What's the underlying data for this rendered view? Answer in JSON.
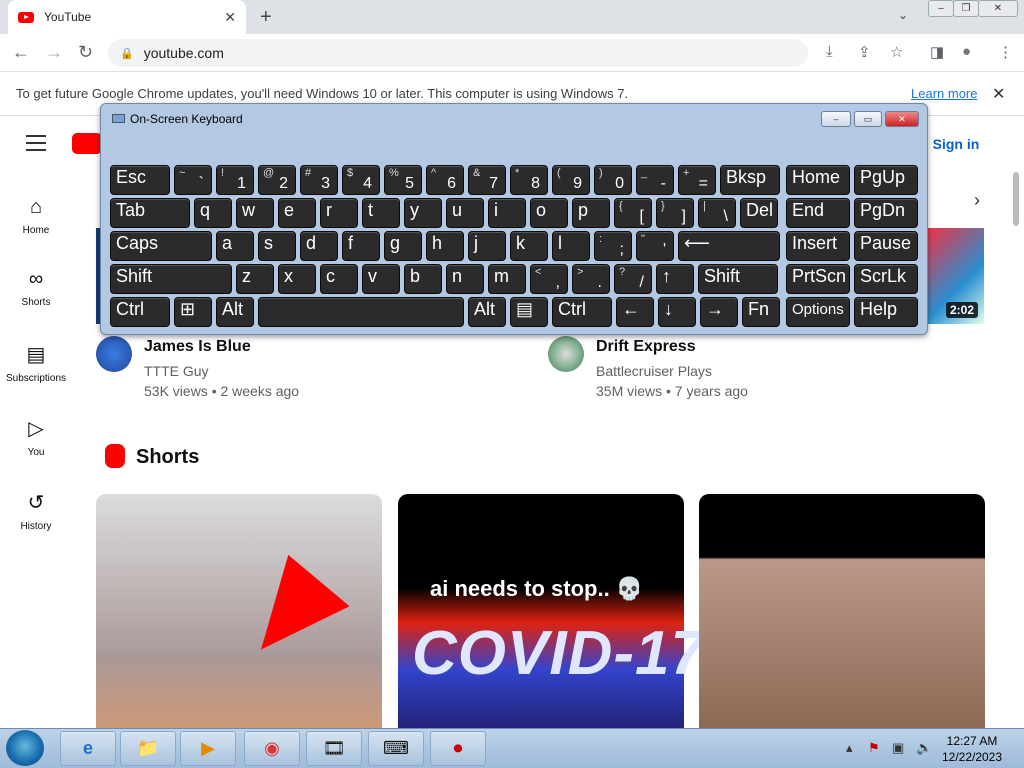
{
  "browser": {
    "tab_title": "YouTube",
    "tab_close": "✕",
    "new_tab": "+",
    "tab_dropdown": "⌄",
    "url": "youtube.com",
    "win_buttons": [
      "‒",
      "❐",
      "✕"
    ],
    "nav": {
      "back": "←",
      "forward": "→",
      "reload": "↻"
    },
    "toolbar_icons": {
      "install": "⤓",
      "share": "⇪",
      "bookmark": "☆",
      "sidepanel": "◨",
      "profile": "●",
      "menu": "⋮"
    }
  },
  "infobar": {
    "message": "To get future Google Chrome updates, you'll need Windows 10 or later. This computer is using Windows 7.",
    "link": "Learn more",
    "close": "✕"
  },
  "youtube": {
    "sign_in": "Sign in",
    "sidebar": [
      {
        "label": "Home",
        "icon": "⌂"
      },
      {
        "label": "Shorts",
        "icon": "∞"
      },
      {
        "label": "Subscriptions",
        "icon": "▤"
      },
      {
        "label": "You",
        "icon": "▷"
      },
      {
        "label": "History",
        "icon": "↺"
      }
    ],
    "duration_badge": "2:02",
    "chip_next": "›",
    "videos": [
      {
        "title": "James Is Blue",
        "channel": "TTTE Guy",
        "meta": "53K views • 2 weeks ago"
      },
      {
        "title": "Drift Express",
        "channel": "Battlecruiser Plays",
        "meta": "35M views • 7 years ago"
      }
    ],
    "shorts_heading": "Shorts",
    "short2_caption": "ai needs to stop.. 💀",
    "short2_big": "COVID-17"
  },
  "keyboard": {
    "title": "On-Screen Keyboard",
    "buttons": [
      "‒",
      "▭",
      "✕"
    ],
    "keys": [
      {
        "m": "Esc",
        "w": 60
      },
      {
        "s": "~",
        "l": "`",
        "w": 38
      },
      {
        "s": "!",
        "l": "1",
        "w": 38
      },
      {
        "s": "@",
        "l": "2",
        "w": 38
      },
      {
        "s": "#",
        "l": "3",
        "w": 38
      },
      {
        "s": "$",
        "l": "4",
        "w": 38
      },
      {
        "s": "%",
        "l": "5",
        "w": 38
      },
      {
        "s": "^",
        "l": "6",
        "w": 38
      },
      {
        "s": "&",
        "l": "7",
        "w": 38
      },
      {
        "s": "*",
        "l": "8",
        "w": 38
      },
      {
        "s": "(",
        "l": "9",
        "w": 38
      },
      {
        "s": ")",
        "l": "0",
        "w": 38
      },
      {
        "s": "_",
        "l": "-",
        "w": 38
      },
      {
        "s": "+",
        "l": "=",
        "w": 38
      },
      {
        "m": "Bksp",
        "w": 60
      },
      {
        "m": "Home",
        "w": 64
      },
      {
        "m": "PgUp",
        "w": 64
      },
      {
        "m": "Tab",
        "w": 80
      },
      {
        "m": "q",
        "w": 38
      },
      {
        "m": "w",
        "w": 38
      },
      {
        "m": "e",
        "w": 38
      },
      {
        "m": "r",
        "w": 38
      },
      {
        "m": "t",
        "w": 38
      },
      {
        "m": "y",
        "w": 38
      },
      {
        "m": "u",
        "w": 38
      },
      {
        "m": "i",
        "w": 38
      },
      {
        "m": "o",
        "w": 38
      },
      {
        "m": "p",
        "w": 38
      },
      {
        "s": "{",
        "l": "[",
        "w": 38
      },
      {
        "s": "}",
        "l": "]",
        "w": 38
      },
      {
        "s": "|",
        "l": "\\",
        "w": 38
      },
      {
        "m": "Del",
        "w": 38
      },
      {
        "m": "End",
        "w": 64
      },
      {
        "m": "PgDn",
        "w": 64
      },
      {
        "m": "Caps",
        "w": 102
      },
      {
        "m": "a",
        "w": 38
      },
      {
        "m": "s",
        "w": 38
      },
      {
        "m": "d",
        "w": 38
      },
      {
        "m": "f",
        "w": 38
      },
      {
        "m": "g",
        "w": 38
      },
      {
        "m": "h",
        "w": 38
      },
      {
        "m": "j",
        "w": 38
      },
      {
        "m": "k",
        "w": 38
      },
      {
        "m": "l",
        "w": 38
      },
      {
        "s": ":",
        "l": ";",
        "w": 38
      },
      {
        "s": "\"",
        "l": "'",
        "w": 38
      },
      {
        "m": "⟵",
        "w": 102
      },
      {
        "m": "Insert",
        "w": 64
      },
      {
        "m": "Pause",
        "w": 64
      },
      {
        "m": "Shift",
        "w": 122
      },
      {
        "m": "z",
        "w": 38
      },
      {
        "m": "x",
        "w": 38
      },
      {
        "m": "c",
        "w": 38
      },
      {
        "m": "v",
        "w": 38
      },
      {
        "m": "b",
        "w": 38
      },
      {
        "m": "n",
        "w": 38
      },
      {
        "m": "m",
        "w": 38
      },
      {
        "s": "<",
        "l": ",",
        "w": 38
      },
      {
        "s": ">",
        "l": ".",
        "w": 38
      },
      {
        "s": "?",
        "l": "/",
        "w": 38
      },
      {
        "m": "↑",
        "w": 38
      },
      {
        "m": "Shift",
        "w": 80
      },
      {
        "m": "PrtScn",
        "w": 64
      },
      {
        "m": "ScrLk",
        "w": 64
      },
      {
        "m": "Ctrl",
        "w": 60
      },
      {
        "m": "⊞",
        "w": 38
      },
      {
        "m": "Alt",
        "w": 38
      },
      {
        "m": "",
        "w": 206
      },
      {
        "m": "Alt",
        "w": 38
      },
      {
        "m": "▤",
        "w": 38
      },
      {
        "m": "Ctrl",
        "w": 60
      },
      {
        "m": "←",
        "w": 38
      },
      {
        "m": "↓",
        "w": 38
      },
      {
        "m": "→",
        "w": 38
      },
      {
        "m": "Fn",
        "w": 38
      },
      {
        "m": "Options",
        "w": 64,
        "opt": true
      },
      {
        "m": "Help",
        "w": 64
      }
    ]
  },
  "taskbar": {
    "apps": [
      "e",
      "📁",
      "▶",
      "◉",
      "🎞",
      "⌨",
      "⏺"
    ],
    "time": "12:27 AM",
    "date": "12/22/2023",
    "tray": [
      "▴",
      "⚑",
      "▣",
      "🔈"
    ]
  }
}
